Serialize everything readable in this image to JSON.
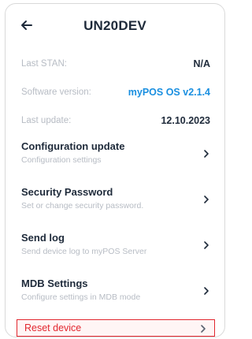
{
  "header": {
    "title": "UN20DEV",
    "back_icon": "arrow-left-icon"
  },
  "info": [
    {
      "label": "Last STAN:",
      "value": "N/A"
    },
    {
      "label": "Software version:",
      "value": "myPOS OS v2.1.4"
    },
    {
      "label": "Last update:",
      "value": "12.10.2023"
    }
  ],
  "menu": [
    {
      "title": "Configuration update",
      "subtitle": "Configuration settings"
    },
    {
      "title": "Security Password",
      "subtitle": "Set or change security password."
    },
    {
      "title": "Send log",
      "subtitle": "Send device log to myPOS Server"
    },
    {
      "title": "MDB Settings",
      "subtitle": "Configure settings in MDB mode"
    }
  ],
  "reset": {
    "label": "Reset device"
  },
  "colors": {
    "accent_blue": "#1a8fe0",
    "danger_red": "#e2272f",
    "text_dark": "#1e2a3a",
    "text_muted": "#b7bcc4"
  }
}
